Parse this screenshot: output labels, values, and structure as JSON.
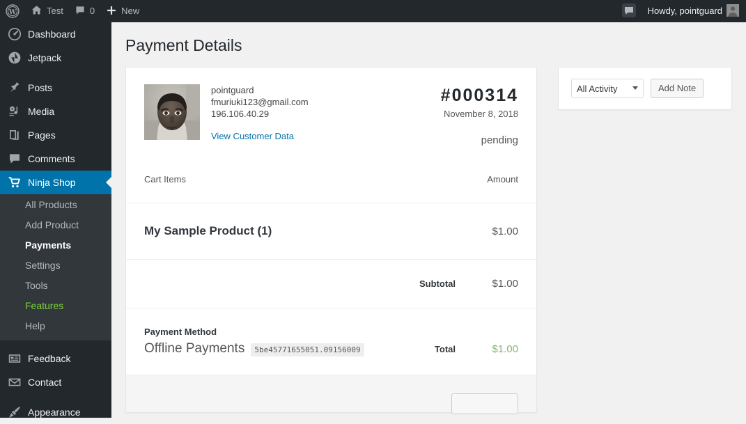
{
  "adminbar": {
    "wp_logo": "wordpress-logo-icon",
    "site_name": "Test",
    "comments_count": "0",
    "new_label": "New",
    "notification_icon": "comment-bubble-icon",
    "greeting": "Howdy, pointguard"
  },
  "sidebar": {
    "top_items": [
      {
        "label": "Dashboard",
        "icon": "dashboard-icon",
        "current": false
      },
      {
        "label": "Jetpack",
        "icon": "jetpack-icon",
        "current": false
      },
      {
        "label": "Posts",
        "icon": "pin-icon",
        "current": false
      },
      {
        "label": "Media",
        "icon": "media-icon",
        "current": false
      },
      {
        "label": "Pages",
        "icon": "pages-icon",
        "current": false
      },
      {
        "label": "Comments",
        "icon": "comments-icon",
        "current": false
      },
      {
        "label": "Ninja Shop",
        "icon": "cart-icon",
        "current": true
      }
    ],
    "submenu": [
      {
        "label": "All Products",
        "state": "normal"
      },
      {
        "label": "Add Product",
        "state": "normal"
      },
      {
        "label": "Payments",
        "state": "current"
      },
      {
        "label": "Settings",
        "state": "normal"
      },
      {
        "label": "Tools",
        "state": "normal"
      },
      {
        "label": "Features",
        "state": "feature"
      },
      {
        "label": "Help",
        "state": "normal"
      }
    ],
    "bottom_items": [
      {
        "label": "Feedback",
        "icon": "feedback-icon"
      },
      {
        "label": "Contact",
        "icon": "envelope-icon"
      },
      {
        "label": "Appearance",
        "icon": "paintbrush-icon"
      }
    ]
  },
  "page": {
    "title": "Payment Details"
  },
  "customer": {
    "avatar": "user-avatar-photo",
    "username": "pointguard",
    "email": "fmuriuki123@gmail.com",
    "ip": "196.106.40.29",
    "view_data_link": "View Customer Data"
  },
  "payment": {
    "number": "#000314",
    "date": "November 8, 2018",
    "status": "pending"
  },
  "cart": {
    "col_items": "Cart Items",
    "col_amount": "Amount",
    "rows": [
      {
        "name": "My Sample Product (1)",
        "amount": "$1.00"
      }
    ],
    "subtotal_label": "Subtotal",
    "subtotal_value": "$1.00",
    "total_label": "Total",
    "total_value": "$1.00"
  },
  "payment_method": {
    "title": "Payment Method",
    "name": "Offline Payments",
    "transaction_id": "5be45771655051.09156009"
  },
  "activity_box": {
    "selected": "All Activity",
    "options": [
      "All Activity"
    ],
    "add_note_label": "Add Note",
    "dropdown_icon": "chevron-down-icon"
  },
  "colors": {
    "accent_blue": "#0073aa",
    "admin_dark": "#23282d",
    "submenu_dark": "#32373c",
    "feature_green": "#7ad03a",
    "total_green": "#8ab66b",
    "page_bg": "#f1f1f1"
  }
}
